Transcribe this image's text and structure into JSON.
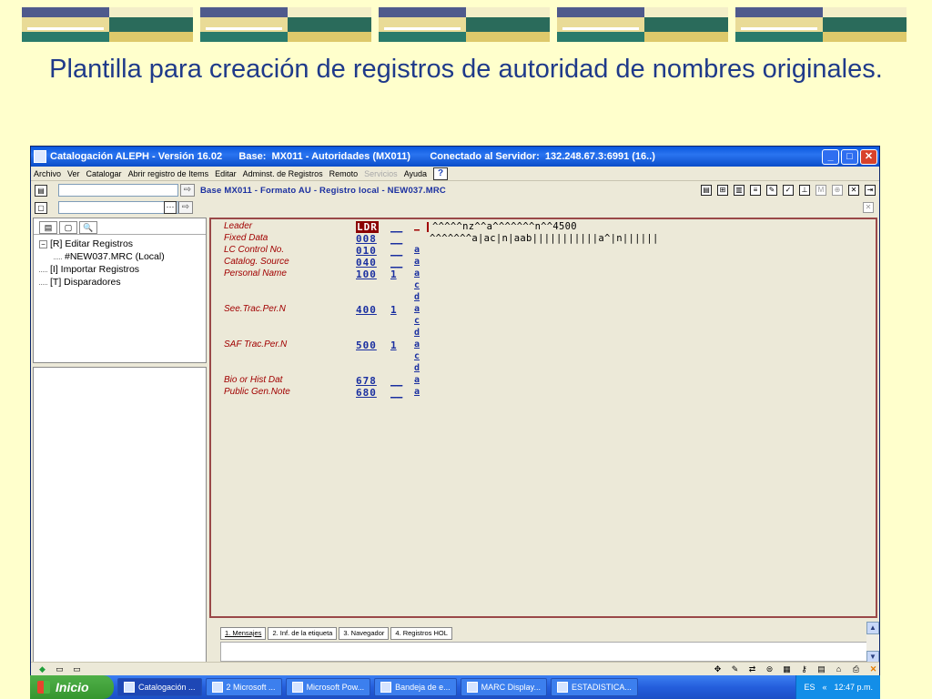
{
  "slide": {
    "title": "Plantilla para creación de registros de autoridad de nombres originales."
  },
  "window": {
    "title": "Catalogación ALEPH - Versión 16.02      Base:  MX011 - Autoridades (MX011)       Conectado al Servidor:  132.248.67.3:6991 (16..)",
    "buttons": {
      "minimize": "_",
      "maximize": "□",
      "close": "✕"
    }
  },
  "menu": {
    "items": [
      "Archivo",
      "Ver",
      "Catalogar",
      "Abrir registro de Items",
      "Editar",
      "Adminst. de Registros",
      "Remoto"
    ],
    "disabled": "Servicios",
    "help": "Ayuda",
    "help_icon": "?"
  },
  "toolbar": {
    "format_label": "Base MX011 - Formato AU - Registro local - NEW037.MRC",
    "dots": "···",
    "arrow": "⇨"
  },
  "left_tabs": [
    "▤",
    "▢",
    "🔍"
  ],
  "tree": {
    "root": "[R] Editar Registros",
    "child": "#NEW037.MRC (Local)",
    "import": "[I] Importar Registros",
    "triggers": "[T] Disparadores"
  },
  "fields": [
    {
      "label": "Leader",
      "tag": "LDR",
      "ind": "",
      "subs": [],
      "value": "^^^^^nz^^a^^^^^^^n^^4500"
    },
    {
      "label": "Fixed Data",
      "tag": "008",
      "ind": "",
      "subs": [],
      "value": "^^^^^^^a|ac|n|aab|||||||||||a^|n||||||"
    },
    {
      "label": "LC Control No.",
      "tag": "010",
      "ind": "",
      "subs": [
        "a"
      ],
      "value": ""
    },
    {
      "label": "Catalog. Source",
      "tag": "040",
      "ind": "",
      "subs": [
        "a"
      ],
      "value": ""
    },
    {
      "label": "Personal Name",
      "tag": "100",
      "ind": "1",
      "subs": [
        "a",
        "c",
        "d"
      ],
      "value": ""
    },
    {
      "label": "See.Trac.Per.N",
      "tag": "400",
      "ind": "1",
      "subs": [
        "a",
        "c",
        "d"
      ],
      "value": ""
    },
    {
      "label": "SAF Trac.Per.N",
      "tag": "500",
      "ind": "1",
      "subs": [
        "a",
        "c",
        "d"
      ],
      "value": ""
    },
    {
      "label": "Bio or Hist Dat",
      "tag": "678",
      "ind": "",
      "subs": [
        "a"
      ],
      "value": ""
    },
    {
      "label": "Public Gen.Note",
      "tag": "680",
      "ind": "",
      "subs": [
        "a"
      ],
      "value": ""
    }
  ],
  "message_tabs": [
    "1. Mensajes",
    "2. Inf. de la etiqueta",
    "3. Navegador",
    "4. Registros HOL"
  ],
  "taskbar": {
    "start": "Inicio",
    "tasks": [
      "Catalogación ...",
      "2 Microsoft ...",
      "Microsoft Pow...",
      "Bandeja de e...",
      "MARC Display...",
      "ESTADISTICA..."
    ],
    "lang": "ES",
    "time": "12:47 p.m."
  },
  "colors": {
    "accent": "#1A2FA0",
    "label": "#A10000",
    "titlebar": "#0A58DE",
    "taskbar": "#245EDC",
    "start": "#36962F"
  }
}
